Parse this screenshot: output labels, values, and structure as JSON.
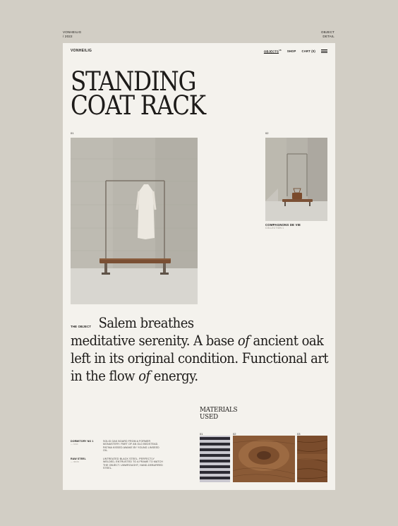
{
  "outer": {
    "brand_line1": "VONHEILIG",
    "brand_line2": "/ 2022",
    "meta_line1": "OBJECT",
    "meta_line2": "DETAIL"
  },
  "header": {
    "logo": "VONHEILIG",
    "nav": {
      "objects": "OBJECTS",
      "objects_sup": "16",
      "shop": "SHOP",
      "cart": "CART (0)"
    }
  },
  "page_title": {
    "line1": "STANDING",
    "line2": "COAT RACK"
  },
  "gallery": [
    {
      "index": "01"
    },
    {
      "index": "02",
      "caption": "COMPAGNONS DE VIE",
      "subcaption": "COLLECTION 1"
    }
  ],
  "object": {
    "label": "THE OBJECT",
    "statement": {
      "l1": "Salem breathes",
      "l2": "meditative serenity. A base ",
      "l2_em": "of",
      "l2_tail": " ancient oak",
      "l3": "left in its original condition. Functional art",
      "l4": "in the flow ",
      "l4_em": "of",
      "l4_tail": " energy."
    }
  },
  "materials": {
    "title_line1": "MATERIALS",
    "title_line2": "USED",
    "rows": [
      {
        "name": "DORMITORY NO 1",
        "sub": "— OAK",
        "desc": "SOLID OAK BOARD FROM A FORMER MONASTERY. PART OF AN OLD BEDSTEAD. PATINA KISSED AWAKE BY YOUNG LINSEED OIL."
      },
      {
        "name": "RAW STEEL",
        "sub": "— IRON",
        "desc": "UNTREATED BLACK STEEL. PERFECTLY WELDED, ENTRUSTED TO A FRAME TO MATCH THE OBJECT. UNWROUGHT, HAND-DEBURRED STEEL."
      }
    ],
    "swatches": [
      {
        "index": "01"
      },
      {
        "index": "02"
      },
      {
        "index": "03"
      }
    ]
  }
}
